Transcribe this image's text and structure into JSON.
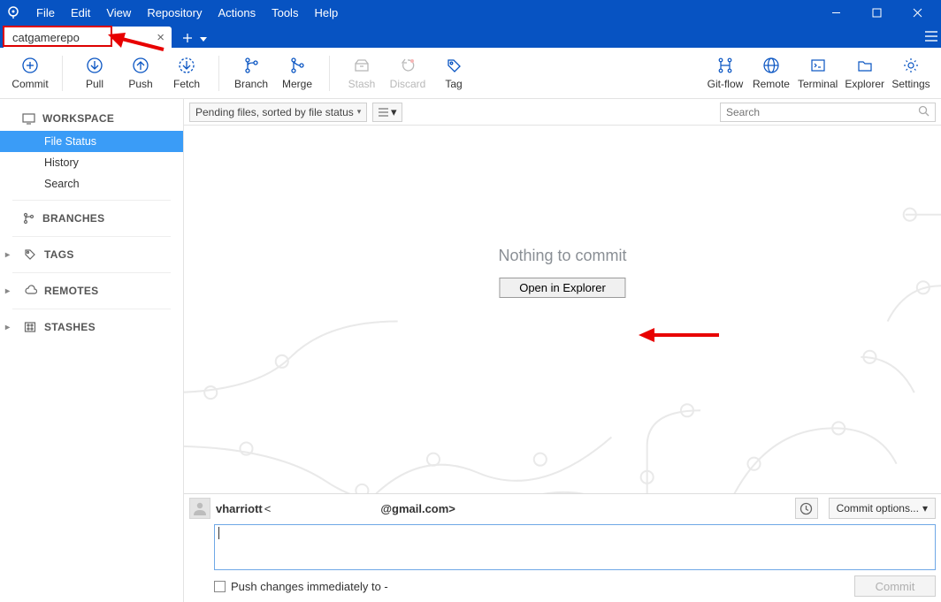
{
  "menu": {
    "items": [
      "File",
      "Edit",
      "View",
      "Repository",
      "Actions",
      "Tools",
      "Help"
    ]
  },
  "tab": {
    "name": "catgamerepo"
  },
  "toolbar": {
    "commit": "Commit",
    "pull": "Pull",
    "push": "Push",
    "fetch": "Fetch",
    "branch": "Branch",
    "merge": "Merge",
    "stash": "Stash",
    "discard": "Discard",
    "tag": "Tag",
    "gitflow": "Git-flow",
    "remote": "Remote",
    "terminal": "Terminal",
    "explorer": "Explorer",
    "settings": "Settings"
  },
  "sidebar": {
    "workspace": {
      "label": "WORKSPACE",
      "items": [
        "File Status",
        "History",
        "Search"
      ]
    },
    "branches": "BRANCHES",
    "tags": "TAGS",
    "remotes": "REMOTES",
    "stashes": "STASHES"
  },
  "filter": {
    "sort": "Pending files, sorted by file status",
    "search_placeholder": "Search"
  },
  "empty": {
    "title": "Nothing to commit",
    "button": "Open in Explorer"
  },
  "commit_area": {
    "author_name": "vharriott",
    "author_email": "@gmail.com>",
    "options": "Commit options...",
    "push_label": "Push changes immediately to -",
    "commit_btn": "Commit"
  }
}
